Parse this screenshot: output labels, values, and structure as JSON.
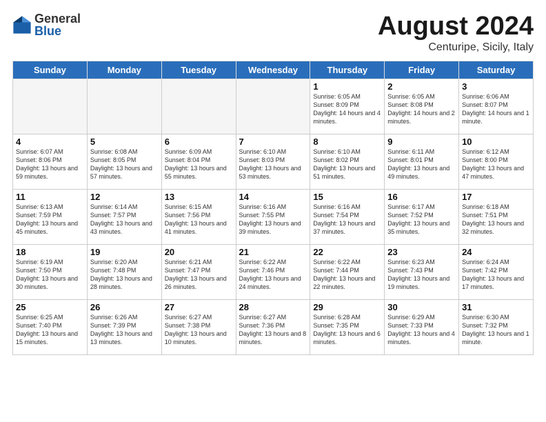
{
  "header": {
    "logo": {
      "general": "General",
      "blue": "Blue"
    },
    "title": "August 2024",
    "location": "Centuripe, Sicily, Italy"
  },
  "days_of_week": [
    "Sunday",
    "Monday",
    "Tuesday",
    "Wednesday",
    "Thursday",
    "Friday",
    "Saturday"
  ],
  "weeks": [
    [
      {
        "day": "",
        "sunrise": "",
        "sunset": "",
        "daylight": "",
        "empty": true
      },
      {
        "day": "",
        "sunrise": "",
        "sunset": "",
        "daylight": "",
        "empty": true
      },
      {
        "day": "",
        "sunrise": "",
        "sunset": "",
        "daylight": "",
        "empty": true
      },
      {
        "day": "",
        "sunrise": "",
        "sunset": "",
        "daylight": "",
        "empty": true
      },
      {
        "day": "1",
        "sunrise": "Sunrise: 6:05 AM",
        "sunset": "Sunset: 8:09 PM",
        "daylight": "Daylight: 14 hours and 4 minutes.",
        "empty": false
      },
      {
        "day": "2",
        "sunrise": "Sunrise: 6:05 AM",
        "sunset": "Sunset: 8:08 PM",
        "daylight": "Daylight: 14 hours and 2 minutes.",
        "empty": false
      },
      {
        "day": "3",
        "sunrise": "Sunrise: 6:06 AM",
        "sunset": "Sunset: 8:07 PM",
        "daylight": "Daylight: 14 hours and 1 minute.",
        "empty": false
      }
    ],
    [
      {
        "day": "4",
        "sunrise": "Sunrise: 6:07 AM",
        "sunset": "Sunset: 8:06 PM",
        "daylight": "Daylight: 13 hours and 59 minutes.",
        "empty": false
      },
      {
        "day": "5",
        "sunrise": "Sunrise: 6:08 AM",
        "sunset": "Sunset: 8:05 PM",
        "daylight": "Daylight: 13 hours and 57 minutes.",
        "empty": false
      },
      {
        "day": "6",
        "sunrise": "Sunrise: 6:09 AM",
        "sunset": "Sunset: 8:04 PM",
        "daylight": "Daylight: 13 hours and 55 minutes.",
        "empty": false
      },
      {
        "day": "7",
        "sunrise": "Sunrise: 6:10 AM",
        "sunset": "Sunset: 8:03 PM",
        "daylight": "Daylight: 13 hours and 53 minutes.",
        "empty": false
      },
      {
        "day": "8",
        "sunrise": "Sunrise: 6:10 AM",
        "sunset": "Sunset: 8:02 PM",
        "daylight": "Daylight: 13 hours and 51 minutes.",
        "empty": false
      },
      {
        "day": "9",
        "sunrise": "Sunrise: 6:11 AM",
        "sunset": "Sunset: 8:01 PM",
        "daylight": "Daylight: 13 hours and 49 minutes.",
        "empty": false
      },
      {
        "day": "10",
        "sunrise": "Sunrise: 6:12 AM",
        "sunset": "Sunset: 8:00 PM",
        "daylight": "Daylight: 13 hours and 47 minutes.",
        "empty": false
      }
    ],
    [
      {
        "day": "11",
        "sunrise": "Sunrise: 6:13 AM",
        "sunset": "Sunset: 7:59 PM",
        "daylight": "Daylight: 13 hours and 45 minutes.",
        "empty": false
      },
      {
        "day": "12",
        "sunrise": "Sunrise: 6:14 AM",
        "sunset": "Sunset: 7:57 PM",
        "daylight": "Daylight: 13 hours and 43 minutes.",
        "empty": false
      },
      {
        "day": "13",
        "sunrise": "Sunrise: 6:15 AM",
        "sunset": "Sunset: 7:56 PM",
        "daylight": "Daylight: 13 hours and 41 minutes.",
        "empty": false
      },
      {
        "day": "14",
        "sunrise": "Sunrise: 6:16 AM",
        "sunset": "Sunset: 7:55 PM",
        "daylight": "Daylight: 13 hours and 39 minutes.",
        "empty": false
      },
      {
        "day": "15",
        "sunrise": "Sunrise: 6:16 AM",
        "sunset": "Sunset: 7:54 PM",
        "daylight": "Daylight: 13 hours and 37 minutes.",
        "empty": false
      },
      {
        "day": "16",
        "sunrise": "Sunrise: 6:17 AM",
        "sunset": "Sunset: 7:52 PM",
        "daylight": "Daylight: 13 hours and 35 minutes.",
        "empty": false
      },
      {
        "day": "17",
        "sunrise": "Sunrise: 6:18 AM",
        "sunset": "Sunset: 7:51 PM",
        "daylight": "Daylight: 13 hours and 32 minutes.",
        "empty": false
      }
    ],
    [
      {
        "day": "18",
        "sunrise": "Sunrise: 6:19 AM",
        "sunset": "Sunset: 7:50 PM",
        "daylight": "Daylight: 13 hours and 30 minutes.",
        "empty": false
      },
      {
        "day": "19",
        "sunrise": "Sunrise: 6:20 AM",
        "sunset": "Sunset: 7:48 PM",
        "daylight": "Daylight: 13 hours and 28 minutes.",
        "empty": false
      },
      {
        "day": "20",
        "sunrise": "Sunrise: 6:21 AM",
        "sunset": "Sunset: 7:47 PM",
        "daylight": "Daylight: 13 hours and 26 minutes.",
        "empty": false
      },
      {
        "day": "21",
        "sunrise": "Sunrise: 6:22 AM",
        "sunset": "Sunset: 7:46 PM",
        "daylight": "Daylight: 13 hours and 24 minutes.",
        "empty": false
      },
      {
        "day": "22",
        "sunrise": "Sunrise: 6:22 AM",
        "sunset": "Sunset: 7:44 PM",
        "daylight": "Daylight: 13 hours and 22 minutes.",
        "empty": false
      },
      {
        "day": "23",
        "sunrise": "Sunrise: 6:23 AM",
        "sunset": "Sunset: 7:43 PM",
        "daylight": "Daylight: 13 hours and 19 minutes.",
        "empty": false
      },
      {
        "day": "24",
        "sunrise": "Sunrise: 6:24 AM",
        "sunset": "Sunset: 7:42 PM",
        "daylight": "Daylight: 13 hours and 17 minutes.",
        "empty": false
      }
    ],
    [
      {
        "day": "25",
        "sunrise": "Sunrise: 6:25 AM",
        "sunset": "Sunset: 7:40 PM",
        "daylight": "Daylight: 13 hours and 15 minutes.",
        "empty": false
      },
      {
        "day": "26",
        "sunrise": "Sunrise: 6:26 AM",
        "sunset": "Sunset: 7:39 PM",
        "daylight": "Daylight: 13 hours and 13 minutes.",
        "empty": false
      },
      {
        "day": "27",
        "sunrise": "Sunrise: 6:27 AM",
        "sunset": "Sunset: 7:38 PM",
        "daylight": "Daylight: 13 hours and 10 minutes.",
        "empty": false
      },
      {
        "day": "28",
        "sunrise": "Sunrise: 6:27 AM",
        "sunset": "Sunset: 7:36 PM",
        "daylight": "Daylight: 13 hours and 8 minutes.",
        "empty": false
      },
      {
        "day": "29",
        "sunrise": "Sunrise: 6:28 AM",
        "sunset": "Sunset: 7:35 PM",
        "daylight": "Daylight: 13 hours and 6 minutes.",
        "empty": false
      },
      {
        "day": "30",
        "sunrise": "Sunrise: 6:29 AM",
        "sunset": "Sunset: 7:33 PM",
        "daylight": "Daylight: 13 hours and 4 minutes.",
        "empty": false
      },
      {
        "day": "31",
        "sunrise": "Sunrise: 6:30 AM",
        "sunset": "Sunset: 7:32 PM",
        "daylight": "Daylight: 13 hours and 1 minute.",
        "empty": false
      }
    ]
  ]
}
